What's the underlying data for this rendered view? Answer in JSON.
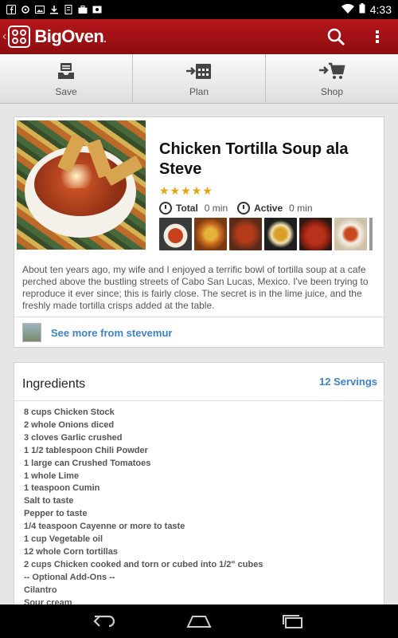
{
  "status_bar": {
    "time": "4:33",
    "left_icons": [
      "facebook-icon",
      "sync-icon",
      "image-icon",
      "download-icon",
      "file-icon",
      "briefcase-icon",
      "photo-icon"
    ],
    "right_icons": [
      "wifi-icon",
      "battery-icon"
    ]
  },
  "app_bar": {
    "logo_text": "BigOven",
    "logo_suffix": ".",
    "icons": [
      "search-icon",
      "overflow-menu-icon"
    ],
    "color": "#a31217"
  },
  "actions": [
    {
      "label": "Save",
      "icon": "save-tray-icon"
    },
    {
      "label": "Plan",
      "icon": "calendar-icon"
    },
    {
      "label": "Shop",
      "icon": "cart-icon"
    }
  ],
  "recipe": {
    "title": "Chicken Tortilla Soup ala Steve",
    "rating": 4.5,
    "stars": "★★★★★",
    "total_label": "Total",
    "total_value": "0 min",
    "active_label": "Active",
    "active_value": "0 min",
    "photo_count_visible": 6,
    "description": "About ten years ago, my wife and I enjoyed a terrific bowl of tortilla soup at a cafe perched above the bustling streets of Cabo San Lucas, Mexico. I've been trying to reproduce it ever since; this is fairly close. The secret is in the lime juice, and the freshly made tortilla crisps added at the table.",
    "author_link": "See more from stevemur"
  },
  "ingredients": {
    "header": "Ingredients",
    "servings": "12 Servings",
    "items": [
      "8 cups Chicken Stock",
      "2 whole Onions diced",
      "3 cloves Garlic crushed",
      "1 1/2 tablespoon Chili Powder",
      "1 large can Crushed Tomatoes",
      "1 whole Lime",
      "1 teaspoon Cumin",
      "Salt to taste",
      "Pepper to taste",
      "1/4 teaspoon Cayenne or more to taste",
      "1 cup Vegetable oil",
      "12 whole Corn tortillas",
      "2 cups Chicken cooked and torn or cubed into 1/2\" cubes",
      "-- Optional Add-Ons --",
      "Cilantro",
      "Sour cream"
    ]
  },
  "nav_bar": {
    "icons": [
      "back-icon",
      "home-icon",
      "recents-icon"
    ]
  },
  "colors": {
    "accent": "#3f82c4",
    "star": "#e3a40f",
    "brand_red": "#a31217"
  }
}
